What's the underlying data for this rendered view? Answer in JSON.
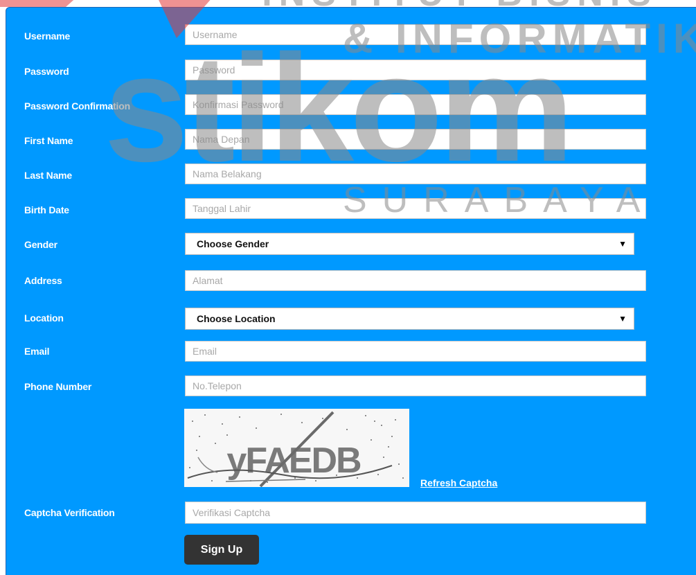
{
  "form": {
    "fields": [
      {
        "label": "Username",
        "placeholder": "Username"
      },
      {
        "label": "Password",
        "placeholder": "Password"
      },
      {
        "label": "Password Confirmation",
        "placeholder": "Konfirmasi Password"
      },
      {
        "label": "First Name",
        "placeholder": "Nama Depan"
      },
      {
        "label": "Last Name",
        "placeholder": "Nama Belakang"
      },
      {
        "label": "Birth Date",
        "placeholder": "Tanggal Lahir"
      }
    ],
    "gender": {
      "label": "Gender",
      "selected": "Choose Gender"
    },
    "address": {
      "label": "Address",
      "placeholder": "Alamat"
    },
    "location": {
      "label": "Location",
      "selected": "Choose Location"
    },
    "email": {
      "label": "Email",
      "placeholder": "Email"
    },
    "phone": {
      "label": "Phone Number",
      "placeholder": "No.Telepon"
    },
    "captcha": {
      "image_text": "yFAEDB",
      "refresh_label": "Refresh Captcha",
      "verification_label": "Captcha Verification",
      "verification_placeholder": "Verifikasi Captcha"
    },
    "signup_label": "Sign Up"
  },
  "watermark": {
    "line1": "INSTITUT BISNIS",
    "line2": "& INFORMATIKA",
    "logo_text": "stikom",
    "city": "SURABAYA"
  },
  "colors": {
    "panel_background": "#0099ff",
    "button_background": "#333333",
    "watermark_red": "#e23a3a",
    "watermark_gray": "#8a8a8a"
  }
}
